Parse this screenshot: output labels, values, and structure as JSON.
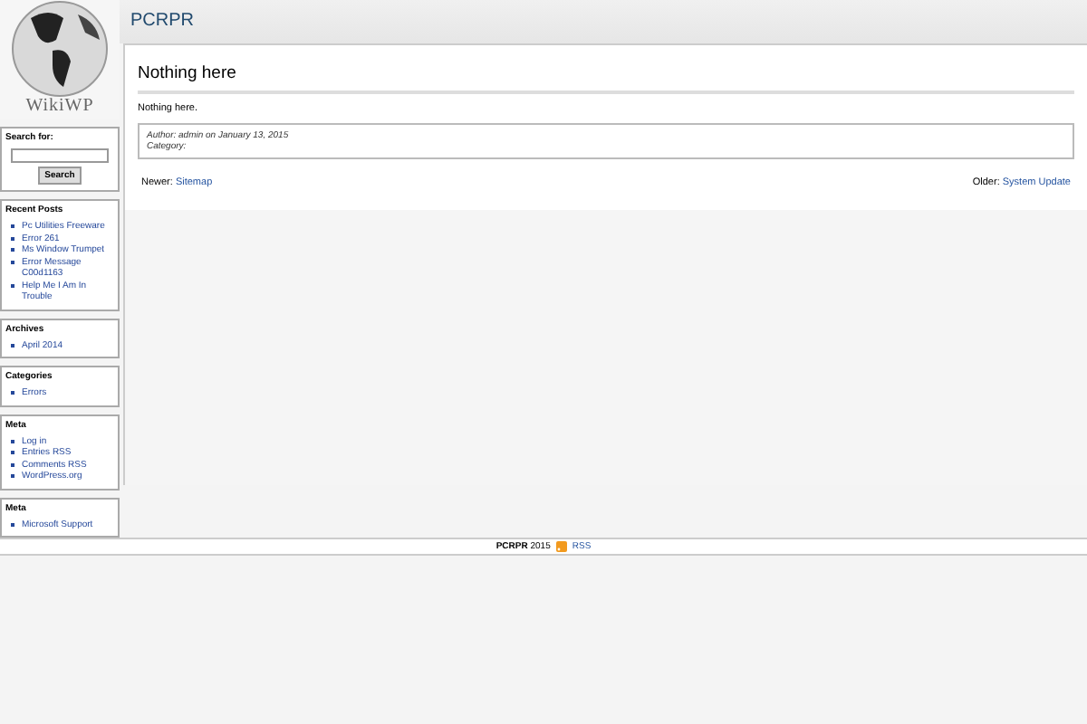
{
  "logo": {
    "text": "WikiWP"
  },
  "site_title": "PCRPR",
  "search": {
    "label": "Search for:",
    "button": "Search"
  },
  "widgets": [
    {
      "title": "Recent Posts",
      "links": [
        "Pc Utilities Freeware",
        "Error 261",
        "Ms Window Trumpet",
        "Error Message C00d1163",
        "Help Me I Am In Trouble"
      ]
    },
    {
      "title": "Archives",
      "links": [
        "April 2014"
      ]
    },
    {
      "title": "Categories",
      "links": [
        "Errors"
      ]
    },
    {
      "title": "Meta",
      "links": [
        "Log in",
        "Entries RSS",
        "Comments RSS",
        "WordPress.org"
      ]
    },
    {
      "title": "Meta",
      "links": [
        "Microsoft Support"
      ]
    }
  ],
  "post": {
    "title": "Nothing here",
    "body": "Nothing here.",
    "meta": [
      "Author: admin on January 13, 2015",
      "Category:"
    ]
  },
  "nav": {
    "newer_label": "Newer:",
    "newer_link": "Sitemap",
    "older_label": "Older:",
    "older_link": "System Update"
  },
  "footer": {
    "site": "PCRPR",
    "year": "2015",
    "rss": "RSS"
  }
}
